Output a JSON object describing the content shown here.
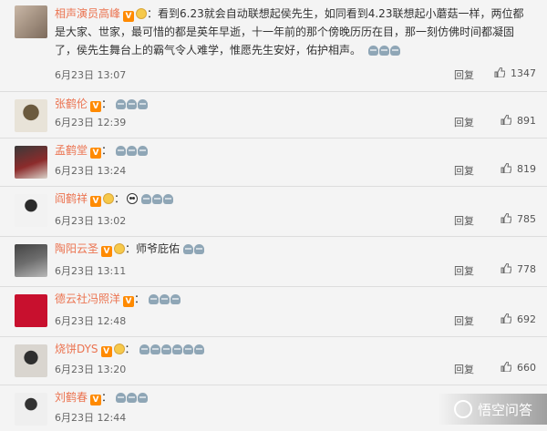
{
  "comments": [
    {
      "name": "相声演员高峰",
      "text": "：看到6.23就会自动联想起侯先生，如同看到4.23联想起小蘑菇一样，两位都是大家、世家，最可惜的都是英年早逝，十一年前的那个傍晚历历在目，那一刻仿佛时间都凝固了，侯先生舞台上的霸气令人难学，惟愿先生安好，佑护相声。",
      "time": "6月23日 13:07",
      "reply": "回复",
      "likes": "1347"
    },
    {
      "name": "张鹤伦",
      "text": "：",
      "time": "6月23日 12:39",
      "reply": "回复",
      "likes": "891"
    },
    {
      "name": "孟鹤堂",
      "text": "：",
      "time": "6月23日 13:24",
      "reply": "回复",
      "likes": "819"
    },
    {
      "name": "阎鹤祥",
      "text": "：",
      "time": "6月23日 13:02",
      "reply": "回复",
      "likes": "785"
    },
    {
      "name": "陶阳云圣",
      "text": "：师爷庇佑",
      "time": "6月23日 13:11",
      "reply": "回复",
      "likes": "778"
    },
    {
      "name": "德云社冯照洋",
      "text": "：",
      "time": "6月23日 12:48",
      "reply": "回复",
      "likes": "692"
    },
    {
      "name": "烧饼DYS",
      "text": "：",
      "time": "6月23日 13:20",
      "reply": "回复",
      "likes": "660"
    },
    {
      "name": "刘鹤春",
      "text": "：",
      "time": "6月23日 12:44",
      "reply": "回复",
      "likes": ""
    }
  ],
  "watermark": {
    "text": "悟空问答"
  },
  "colors": {
    "name": "#eb7350",
    "badge": "#ff8a00"
  }
}
